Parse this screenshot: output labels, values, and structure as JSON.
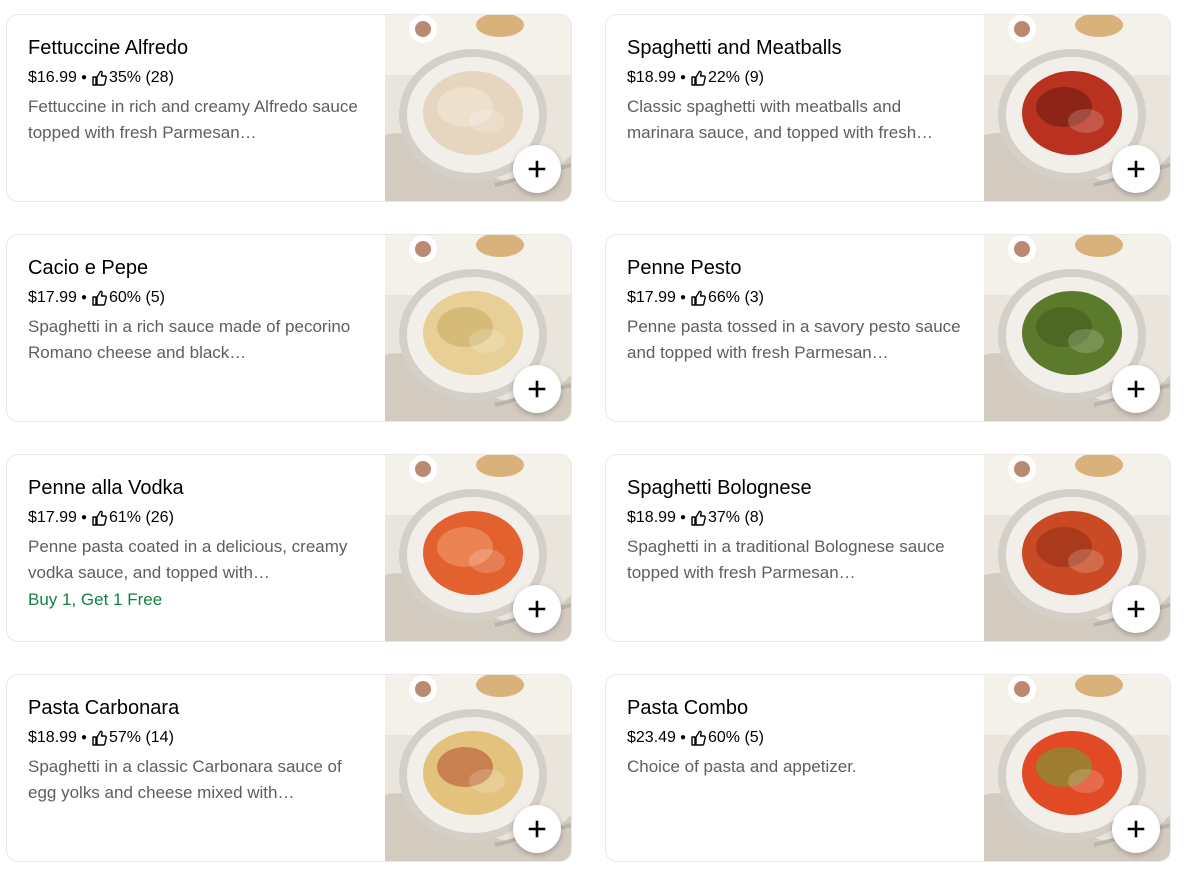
{
  "menu_items": [
    {
      "title": "Fettuccine Alfredo",
      "price": "$16.99",
      "rating": "35% (28)",
      "description": "Fettuccine in rich and creamy Alfredo sauce topped with fresh Parmesan…",
      "promo": "",
      "image_icon": "fettuccine-alfredo-photo",
      "pasta_color": "#e6d6bf",
      "accent_color": "#f3ead9"
    },
    {
      "title": "Spaghetti and Meatballs",
      "price": "$18.99",
      "rating": "22% (9)",
      "description": "Classic spaghetti with meatballs and marinara sauce, and topped with fresh…",
      "promo": "",
      "image_icon": "spaghetti-meatballs-photo",
      "pasta_color": "#b8321f",
      "accent_color": "#6a1a12"
    },
    {
      "title": "Cacio e Pepe",
      "price": "$17.99",
      "rating": "60% (5)",
      "description": "Spaghetti in a rich sauce made of pecorino Romano cheese and black…",
      "promo": "",
      "image_icon": "cacio-e-pepe-photo",
      "pasta_color": "#e7cf95",
      "accent_color": "#c9a961"
    },
    {
      "title": "Penne Pesto",
      "price": "$17.99",
      "rating": "66% (3)",
      "description": "Penne pasta tossed in a savory pesto sauce and topped with fresh Parmesan…",
      "promo": "",
      "image_icon": "penne-pesto-photo",
      "pasta_color": "#5b7a2c",
      "accent_color": "#3f5a1c"
    },
    {
      "title": "Penne alla Vodka",
      "price": "$17.99",
      "rating": "61% (26)",
      "description": "Penne pasta coated in a delicious, creamy vodka sauce, and topped with…",
      "promo": "Buy 1, Get 1 Free",
      "image_icon": "penne-vodka-photo",
      "pasta_color": "#e2612f",
      "accent_color": "#f3a06f"
    },
    {
      "title": "Spaghetti Bolognese",
      "price": "$18.99",
      "rating": "37% (8)",
      "description": "Spaghetti in a traditional Bolognese sauce topped with fresh Parmesan…",
      "promo": "",
      "image_icon": "spaghetti-bolognese-photo",
      "pasta_color": "#c94a24",
      "accent_color": "#8f2e14"
    },
    {
      "title": "Pasta Carbonara",
      "price": "$18.99",
      "rating": "57% (14)",
      "description": "Spaghetti in a classic Carbonara sauce of egg yolks and cheese mixed with…",
      "promo": "",
      "image_icon": "pasta-carbonara-photo",
      "pasta_color": "#e3c27d",
      "accent_color": "#b24a2b"
    },
    {
      "title": "Pasta Combo",
      "price": "$23.49",
      "rating": "60% (5)",
      "description": "Choice of pasta and appetizer.",
      "promo": "",
      "image_icon": "pasta-combo-photo",
      "pasta_color": "#e14a24",
      "accent_color": "#6aa83a"
    }
  ],
  "colors": {
    "promo_green": "#0e8345",
    "description_gray": "#5e5e5e",
    "card_border": "#e8e8e8"
  },
  "icons": {
    "rating": "thumbs-up-icon",
    "add": "plus-icon"
  }
}
